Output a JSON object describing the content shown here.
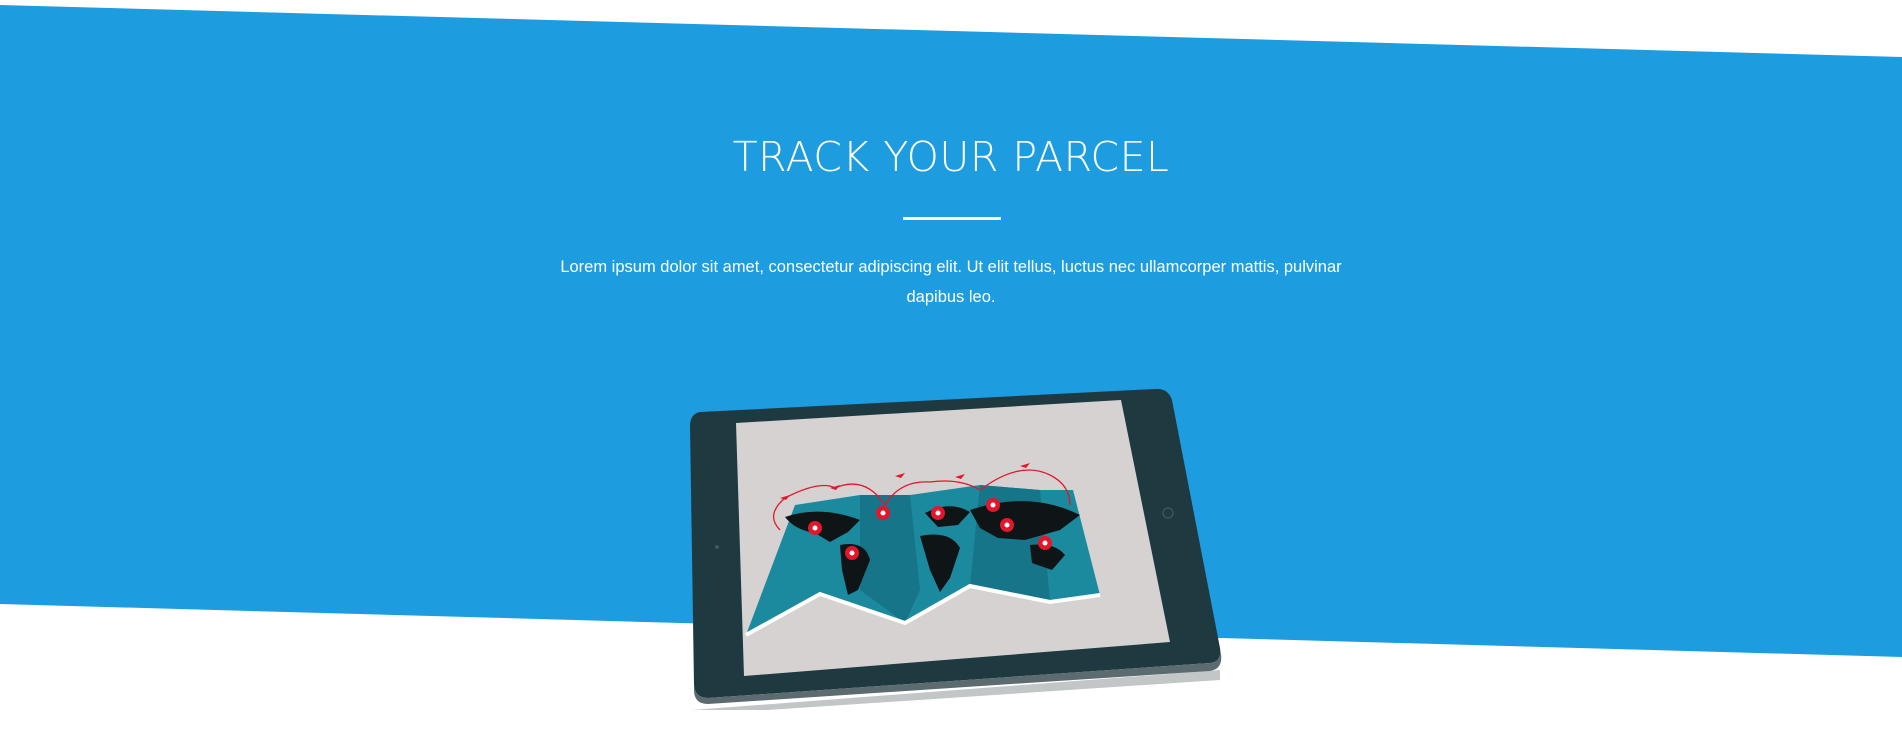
{
  "section": {
    "title": "TRACK YOUR PARCEL",
    "description": "Lorem ipsum dolor sit amet, consectetur adipiscing elit. Ut elit tellus, luctus nec ullamcorper mattis, pulvinar dapibus leo."
  },
  "colors": {
    "band": "#1d9de0",
    "background": "#ffffff",
    "text": "#ffffff",
    "tablet_frame": "#1e3a40",
    "map_teal": "#1b8a9e",
    "marker_red": "#e3162b"
  },
  "image": {
    "icon": "tablet-world-map-image"
  }
}
